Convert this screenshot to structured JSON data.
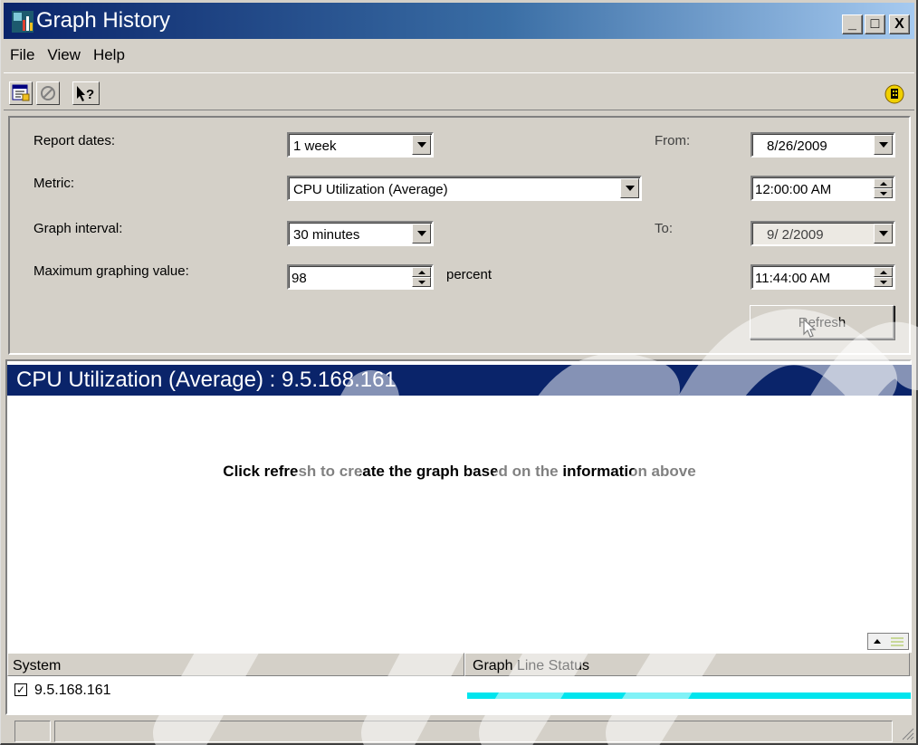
{
  "window": {
    "title": "Graph History",
    "minimize_glyph": "_",
    "maximize_glyph": "□",
    "close_glyph": "X"
  },
  "menu": [
    "File",
    "View",
    "Help"
  ],
  "toolbar": {
    "icons": [
      "properties-icon",
      "stop-icon",
      "whats-this-help-icon"
    ],
    "status_icon": "connection-status-icon"
  },
  "params": {
    "report_dates": {
      "label": "Report dates:",
      "value": "1 week"
    },
    "metric": {
      "label": "Metric:",
      "value": "CPU Utilization (Average)"
    },
    "graph_interval": {
      "label": "Graph interval:",
      "value": "30 minutes"
    },
    "max_value": {
      "label": "Maximum graphing value:",
      "value": "98",
      "unit": "percent"
    },
    "from": {
      "label": "From:",
      "date": "8/26/2009",
      "time": "12:00:00 AM"
    },
    "to": {
      "label": "To:",
      "date": "9/ 2/2009",
      "time": "11:44:00 AM"
    },
    "refresh_label": "Refresh"
  },
  "graph": {
    "header": "CPU Utilization (Average) : 9.5.168.161",
    "message": "Click refresh to create the graph based on the information above"
  },
  "table": {
    "columns": [
      "System",
      "Graph Line Status"
    ],
    "rows": [
      {
        "system": "9.5.168.161",
        "checked": true,
        "line_color": "#00e5ee"
      }
    ]
  },
  "colors": {
    "title_bar": "#0a246a",
    "graph_header": "#0a246a",
    "line_status": "#00e5ee"
  }
}
